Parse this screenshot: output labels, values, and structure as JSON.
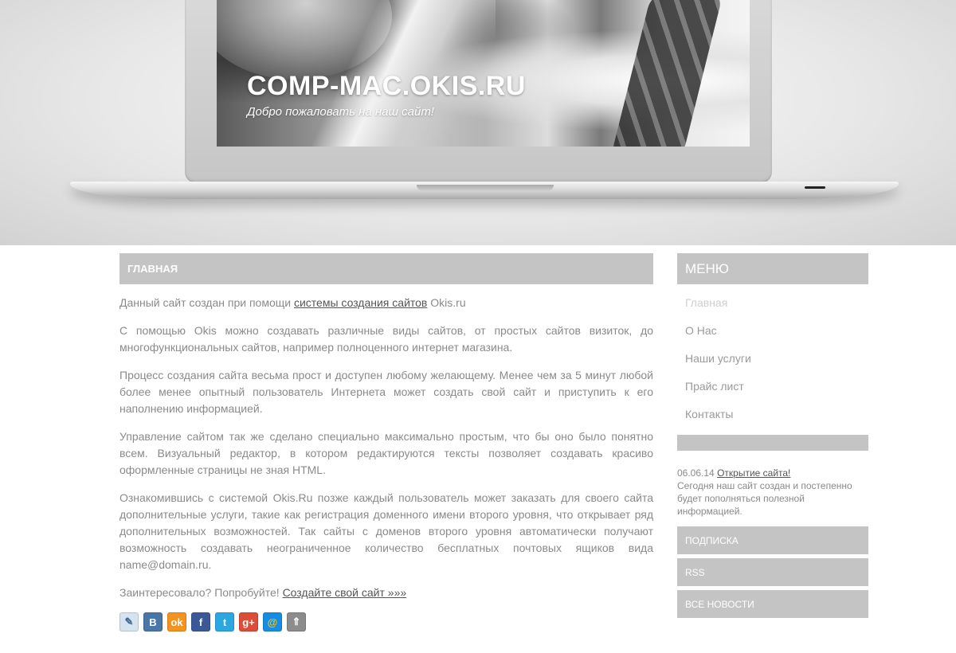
{
  "header": {
    "site_title": "COMP-MAC.OKIS.RU",
    "slogan": "Добро пожаловать на наш сайт!"
  },
  "main": {
    "title": "ГЛАВНАЯ",
    "p1": {
      "before": "Данный сайт создан при помощи ",
      "link": "системы создания сайтов",
      "after": " Okis.ru"
    },
    "p2": "С помощью Okis можно создавать различные виды сайтов, от простых сайтов визиток, до многофункциональных сайтов, например полноценного интернет магазина.",
    "p3": "Процесс создания сайта весьма прост и доступен любому желающему. Менее чем за 5 минут любой более менее опытный пользователь Интернета может создать свой сайт и приступить к его наполнению информацией.",
    "p4": "Управление сайтом так же сделано специально максимально простым, что бы оно было понятно всем. Визуальный редактор, в котором редактируются тексты позволяет создавать красиво оформленные страницы не зная HTML.",
    "p5": "Ознакомившись с системой Okis.Ru позже каждый пользователь может заказать для своего сайта дополнительные услуги, такие как регистрация доменного имени второго уровня, что открывает ряд дополнительных возможностей. Так сайты с доменов второго уровня автоматически получают возможность создавать неограниченное количество бесплатных почтовых ящиков вида name@domain.ru.",
    "p6": {
      "before": "Заинтересовало? Попробуйте! ",
      "link": "Создайте свой сайт »»»"
    },
    "share": [
      {
        "icon": "livejournal-icon",
        "glyph": "✎",
        "color": "#d6e4f0",
        "text_color": "#3b6a9a"
      },
      {
        "icon": "vkontakte-icon",
        "glyph": "В",
        "color": "#4a76a8",
        "text_color": "#ffffff"
      },
      {
        "icon": "odnoklassniki-icon",
        "glyph": "ok",
        "color": "#f4931f",
        "text_color": "#ffffff"
      },
      {
        "icon": "facebook-icon",
        "glyph": "f",
        "color": "#3b5998",
        "text_color": "#ffffff"
      },
      {
        "icon": "twitter-icon",
        "glyph": "t",
        "color": "#2ca7e0",
        "text_color": "#ffffff"
      },
      {
        "icon": "google-plus-icon",
        "glyph": "g+",
        "color": "#dd4b39",
        "text_color": "#ffffff"
      },
      {
        "icon": "mailru-icon",
        "glyph": "@",
        "color": "#168de2",
        "text_color": "#ffc000"
      },
      {
        "icon": "more-share-icon",
        "glyph": "⇑",
        "color": "#8c8c8c",
        "text_color": "#ffffff"
      }
    ]
  },
  "sidebar": {
    "menu_title": "МЕНЮ",
    "menu_items": [
      {
        "label": "Главная"
      },
      {
        "label": "О Нас"
      },
      {
        "label": "Наши услуги"
      },
      {
        "label": "Прайс лист"
      },
      {
        "label": "Контакты"
      }
    ],
    "news": {
      "date": "06.06.14",
      "title": "Открытие сайта!",
      "text": "Сегодня наш сайт создан и постепенно будет пополняться полезной информацией."
    },
    "buttons": {
      "subscribe": "ПОДПИСКА",
      "rss": "RSS",
      "all_news": "ВСЕ НОВОСТИ"
    }
  }
}
